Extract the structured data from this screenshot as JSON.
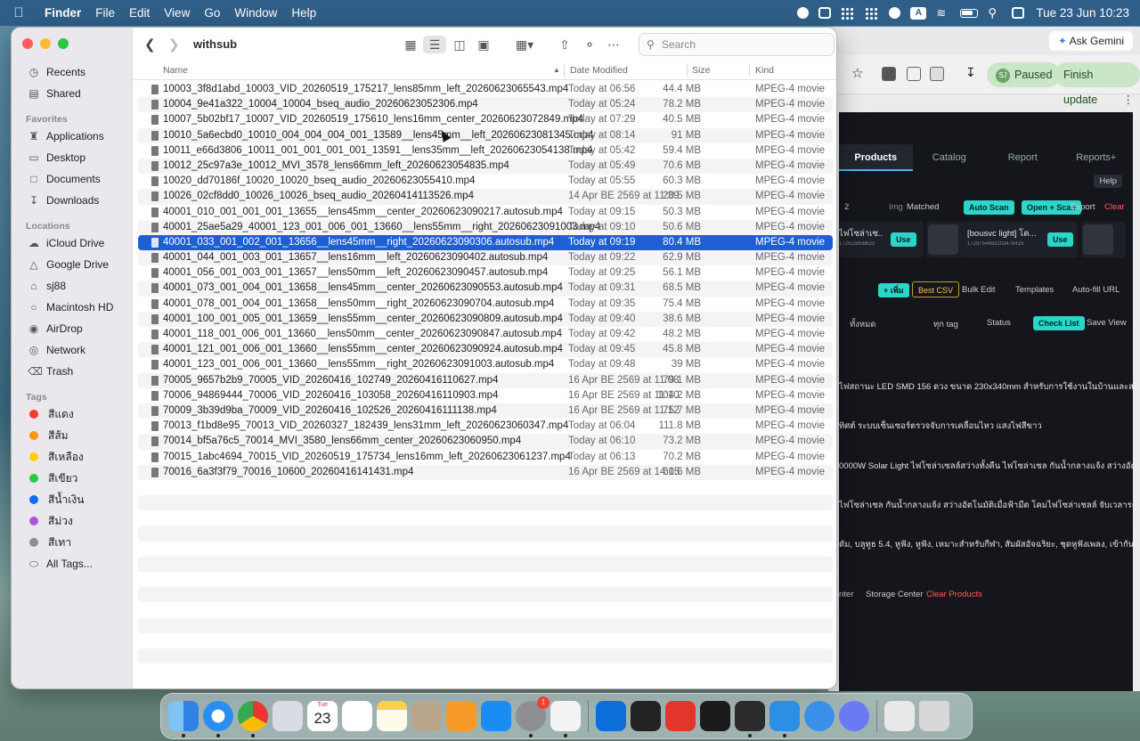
{
  "menubar": {
    "app": "Finder",
    "items": [
      "File",
      "Edit",
      "View",
      "Go",
      "Window",
      "Help"
    ],
    "status_a": "A",
    "clock": "Tue 23 Jun  10:23"
  },
  "background_app": {
    "ask_gemini": "Ask Gemini",
    "paused": "Paused",
    "paused_avatar": "SJ",
    "finish_update": "Finish update",
    "tabs": [
      "Products",
      "Catalog",
      "Report",
      "Reports+"
    ],
    "help": "Help",
    "qty": "2",
    "img_label": "Img",
    "matched": "Matched",
    "auto_scan": "Auto Scan",
    "open_scan": "Open + Scan",
    "export": "Export",
    "clear": "Clear",
    "card1_title": "ไฟโซล่าเซ...",
    "card1_id": "172923858633",
    "card2_title": "[bousvc light] โค...",
    "card2_id": "1729754483203476425",
    "use": "Use",
    "add": "+ เพิ่ม",
    "best_csv": "Best CSV",
    "bulk_edit": "Bulk Edit",
    "templates": "Templates",
    "autofill": "Auto-fill URL",
    "all_filter": "ทั้งหมด",
    "tag_filter": "ทุก tag",
    "status": "Status",
    "check_list": "Check List",
    "save_view": "Save View",
    "desc1": "ไฟสถานะ LED SMD 156 ดวง ขนาด 230x340mm สำหรับการใช้งานในบ้านและสวน",
    "desc2": "ทิศต์ ระบบเซ็นเซอร์ตรวจจับการเคลื่อนไหว แสงไฟสีขาว",
    "desc3": "0000W Solar Light ไฟโซล่าเซลล์สว่างทั้งคืน ไฟโซล่าเซล กันน้ำกลางแจ้ง สว่างอัตโนมัติเมื่อฟ้ามืด",
    "desc4": "ไฟโซล่าเซล กันน้ำกลางแจ้ง สว่างอัตโนมัติเมื่อฟ้ามืด โคมไฟโซล่าเซลล์ จับเวลาระยะไกล หลอดไฟ",
    "desc5": "ตัม, บลูทูธ 5.4, หูฟัง, หูฟัง, เหมาะสำหรับกีฬา, สัมผัสอัจฉริยะ, ชุดหูฟังเพลง, เข้ากันได้กับสมาร์ทโ",
    "center": "nter",
    "storage_center": "Storage Center",
    "clear_products": "Clear Products"
  },
  "finder": {
    "title": "withsub",
    "search_placeholder": "Search",
    "columns": {
      "name": "Name",
      "date": "Date Modified",
      "size": "Size",
      "kind": "Kind"
    },
    "sidebar": {
      "favorites_label": "Favorites",
      "favorites": [
        "Recents",
        "Shared",
        "Applications",
        "Desktop",
        "Documents",
        "Downloads"
      ],
      "locations_label": "Locations",
      "locations": [
        "iCloud Drive",
        "Google Drive",
        "sj88",
        "Macintosh HD",
        "AirDrop",
        "Network",
        "Trash"
      ],
      "tags_label": "Tags",
      "tags": [
        {
          "name": "สีแดง",
          "color": "#ff3b30"
        },
        {
          "name": "สีส้ม",
          "color": "#ff9500"
        },
        {
          "name": "สีเหลือง",
          "color": "#ffcc00"
        },
        {
          "name": "สีเขียว",
          "color": "#28c840"
        },
        {
          "name": "สีน้ำเงิน",
          "color": "#0a6cff"
        },
        {
          "name": "สีม่วง",
          "color": "#af52de"
        },
        {
          "name": "สีเทา",
          "color": "#8e8e93"
        }
      ],
      "all_tags": "All Tags..."
    },
    "files": [
      {
        "name": "10003_3f8d1abd_10003_VID_20260519_175217_lens85mm_left_20260623065543.mp4",
        "date": "Today at 06:56",
        "size": "44.4 MB",
        "kind": "MPEG-4 movie"
      },
      {
        "name": "10004_9e41a322_10004_10004_bseq_audio_20260623052306.mp4",
        "date": "Today at 05:24",
        "size": "78.2 MB",
        "kind": "MPEG-4 movie"
      },
      {
        "name": "10007_5b02bf17_10007_VID_20260519_175610_lens16mm_center_20260623072849.mp4",
        "date": "Today at 07:29",
        "size": "40.5 MB",
        "kind": "MPEG-4 movie"
      },
      {
        "name": "10010_5a6ecbd0_10010_004_004_004_001_13589__lens45mm__left_20260623081345.mp4",
        "date": "Today at 08:14",
        "size": "91 MB",
        "kind": "MPEG-4 movie"
      },
      {
        "name": "10011_e66d3806_10011_001_001_001_001_13591__lens35mm__left_20260623054138.mp4",
        "date": "Today at 05:42",
        "size": "59.4 MB",
        "kind": "MPEG-4 movie"
      },
      {
        "name": "10012_25c97a3e_10012_MVI_3578_lens66mm_left_20260623054835.mp4",
        "date": "Today at 05:49",
        "size": "70.6 MB",
        "kind": "MPEG-4 movie"
      },
      {
        "name": "10020_dd70186f_10020_10020_bseq_audio_20260623055410.mp4",
        "date": "Today at 05:55",
        "size": "60.3 MB",
        "kind": "MPEG-4 movie"
      },
      {
        "name": "10026_02cf8dd0_10026_10026_bseq_audio_20260414113526.mp4",
        "date": "14 Apr BE 2569 at 11:39",
        "size": "20.5 MB",
        "kind": "MPEG-4 movie"
      },
      {
        "name": "40001_010_001_001_001_13655__lens45mm__center_20260623090217.autosub.mp4",
        "date": "Today at 09:15",
        "size": "50.3 MB",
        "kind": "MPEG-4 movie"
      },
      {
        "name": "40001_25ae5a29_40001_123_001_006_001_13660__lens55mm__right_20260623091003.mp4",
        "date": "Today at 09:10",
        "size": "50.6 MB",
        "kind": "MPEG-4 movie"
      },
      {
        "name": "40001_033_001_002_001_13656__lens45mm__right_20260623090306.autosub.mp4",
        "date": "Today at 09:19",
        "size": "80.4 MB",
        "kind": "MPEG-4 movie",
        "selected": true
      },
      {
        "name": "40001_044_001_003_001_13657__lens16mm__left_20260623090402.autosub.mp4",
        "date": "Today at 09:22",
        "size": "62.9 MB",
        "kind": "MPEG-4 movie"
      },
      {
        "name": "40001_056_001_003_001_13657__lens50mm__left_20260623090457.autosub.mp4",
        "date": "Today at 09:25",
        "size": "56.1 MB",
        "kind": "MPEG-4 movie"
      },
      {
        "name": "40001_073_001_004_001_13658__lens45mm__center_20260623090553.autosub.mp4",
        "date": "Today at 09:31",
        "size": "68.5 MB",
        "kind": "MPEG-4 movie"
      },
      {
        "name": "40001_078_001_004_001_13658__lens50mm__right_20260623090704.autosub.mp4",
        "date": "Today at 09:35",
        "size": "75.4 MB",
        "kind": "MPEG-4 movie"
      },
      {
        "name": "40001_100_001_005_001_13659__lens55mm__center_20260623090809.autosub.mp4",
        "date": "Today at 09:40",
        "size": "38.6 MB",
        "kind": "MPEG-4 movie"
      },
      {
        "name": "40001_118_001_006_001_13660__lens50mm__center_20260623090847.autosub.mp4",
        "date": "Today at 09:42",
        "size": "48.2 MB",
        "kind": "MPEG-4 movie"
      },
      {
        "name": "40001_121_001_006_001_13660__lens55mm__center_20260623090924.autosub.mp4",
        "date": "Today at 09:45",
        "size": "45.8 MB",
        "kind": "MPEG-4 movie"
      },
      {
        "name": "40001_123_001_006_001_13660__lens55mm__right_20260623091003.autosub.mp4",
        "date": "Today at 09:48",
        "size": "39 MB",
        "kind": "MPEG-4 movie"
      },
      {
        "name": "70005_9657b2b9_70005_VID_20260416_102749_20260416110627.mp4",
        "date": "16 Apr BE 2569 at 11:08",
        "size": "79.1 MB",
        "kind": "MPEG-4 movie"
      },
      {
        "name": "70006_94869444_70006_VID_20260416_103058_20260416110903.mp4",
        "date": "16 Apr BE 2569 at 11:10",
        "size": "104.2 MB",
        "kind": "MPEG-4 movie"
      },
      {
        "name": "70009_3b39d9ba_70009_VID_20260416_102526_20260416111138.mp4",
        "date": "16 Apr BE 2569 at 11:12",
        "size": "75.7 MB",
        "kind": "MPEG-4 movie"
      },
      {
        "name": "70013_f1bd8e95_70013_VID_20260327_182439_lens31mm_left_20260623060347.mp4",
        "date": "Today at 06:04",
        "size": "111.8 MB",
        "kind": "MPEG-4 movie"
      },
      {
        "name": "70014_bf5a76c5_70014_MVI_3580_lens66mm_center_20260623060950.mp4",
        "date": "Today at 06:10",
        "size": "73.2 MB",
        "kind": "MPEG-4 movie"
      },
      {
        "name": "70015_1abc4694_70015_VID_20260519_175734_lens16mm_left_20260623061237.mp4",
        "date": "Today at 06:13",
        "size": "70.2 MB",
        "kind": "MPEG-4 movie"
      },
      {
        "name": "70016_6a3f3f79_70016_10600_20260416141431.mp4",
        "date": "16 Apr BE 2569 at 14:15",
        "size": "60.6 MB",
        "kind": "MPEG-4 movie"
      }
    ]
  },
  "dock": {
    "calendar_month": "Tue",
    "calendar_day": "23",
    "settings_badge": "1",
    "apps": [
      "finder-icon",
      "safari-icon",
      "chrome-icon",
      "launchpad-icon",
      "calendar-icon",
      "reminders-icon",
      "notes-icon",
      "contacts-icon",
      "pages-icon",
      "app-store-icon",
      "system-settings-icon",
      "agent-icon",
      "windows-app-icon",
      "dots-app-icon",
      "m-app-icon",
      "activity-monitor-icon",
      "terminal-icon",
      "vscode-icon",
      "qbittorrent-icon",
      "proton-icon",
      "preview-icon",
      "trash-icon"
    ]
  }
}
